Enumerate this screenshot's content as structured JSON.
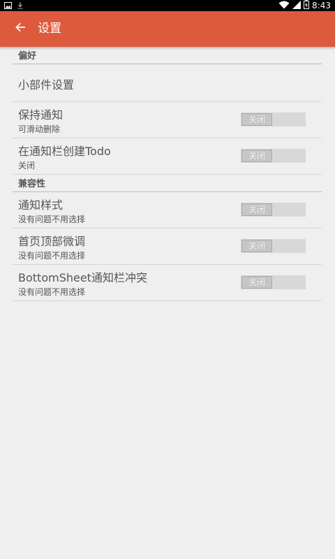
{
  "status_bar": {
    "time": "8:43",
    "icons": [
      "image-icon",
      "download-icon",
      "wifi-icon",
      "signal-icon",
      "battery-icon"
    ]
  },
  "app_bar": {
    "title": "设置",
    "color": "#de5a3c",
    "back_icon": "arrow-left-icon"
  },
  "sections": {
    "preferences": {
      "header": "偏好",
      "widget_settings": {
        "title": "小部件设置"
      },
      "keep_notification": {
        "title": "保持通知",
        "summary": "可滑动删除",
        "toggle_label": "关闭",
        "checked": false
      },
      "create_todo_notification": {
        "title": "在通知栏创建Todo",
        "summary": "关闭",
        "toggle_label": "关闭",
        "checked": false
      }
    },
    "compatibility": {
      "header": "兼容性",
      "notification_style": {
        "title": "通知样式",
        "summary": "没有问题不用选择",
        "toggle_label": "关闭",
        "checked": false
      },
      "home_top_adjust": {
        "title": "首页顶部微调",
        "summary": "没有问题不用选择",
        "toggle_label": "关闭",
        "checked": false
      },
      "bottomsheet_conflict": {
        "title": "BottomSheet通知栏冲突",
        "summary": "没有问题不用选择",
        "toggle_label": "关闭",
        "checked": false
      }
    }
  }
}
